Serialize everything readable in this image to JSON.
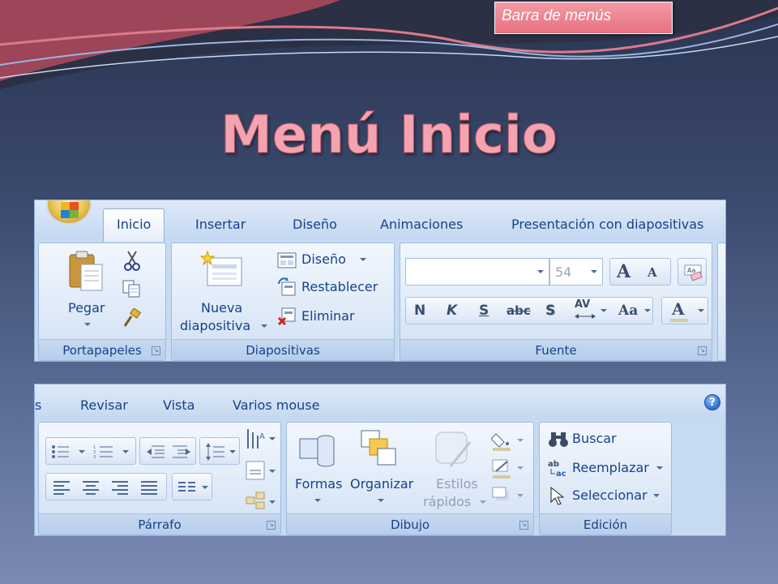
{
  "slide": {
    "callout": "Barra de menús",
    "title": "Menú Inicio"
  },
  "ribbon_top": {
    "tabs": [
      "Inicio",
      "Insertar",
      "Diseño",
      "Animaciones",
      "Presentación con diapositivas"
    ],
    "active_tab": "Inicio",
    "portapapeles": {
      "label": "Portapapeles",
      "paste": "Pegar",
      "cut_icon": "scissors-icon",
      "copy_icon": "copy-icon",
      "format_painter_icon": "format-painter-icon"
    },
    "diapositivas": {
      "label": "Diapositivas",
      "new_slide_line1": "Nueva",
      "new_slide_line2": "diapositiva",
      "layout": "Diseño",
      "reset": "Restablecer",
      "delete": "Eliminar"
    },
    "fuente": {
      "label": "Fuente",
      "font_name": "",
      "font_size": "54",
      "grow": "A",
      "shrink": "A",
      "bold": "N",
      "italic": "K",
      "underline": "S",
      "strike": "abc",
      "shadow": "S",
      "spacing": "AV",
      "case": "Aa",
      "color": "A"
    }
  },
  "ribbon_bottom": {
    "tab_partial": "s",
    "tabs": [
      "Revisar",
      "Vista",
      "Varios mouse"
    ],
    "help": "?",
    "parrafo": {
      "label": "Párrafo"
    },
    "dibujo": {
      "label": "Dibujo",
      "shapes": "Formas",
      "arrange": "Organizar",
      "quick_styles_line1": "Estilos",
      "quick_styles_line2": "rápidos"
    },
    "edicion": {
      "label": "Edición",
      "find": "Buscar",
      "replace": "Reemplazar",
      "select": "Seleccionar"
    }
  },
  "colors": {
    "accent_pink": "#f3a4b0",
    "ribbon_text": "#15428b",
    "ribbon_bg": "#c6daf2"
  }
}
